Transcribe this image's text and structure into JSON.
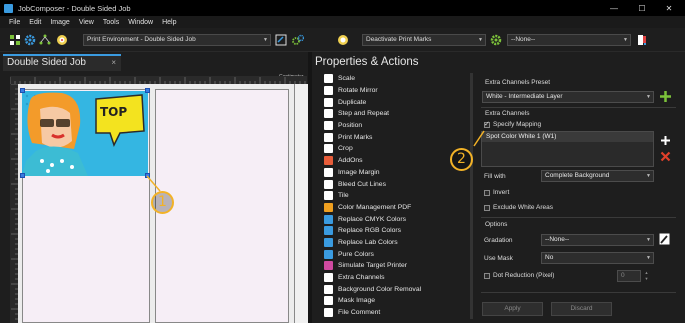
{
  "window": {
    "title": "JobComposer - Double Sided Job",
    "minimize": "—",
    "maximize": "☐",
    "close": "✕"
  },
  "menu": [
    "File",
    "Edit",
    "Image",
    "View",
    "Tools",
    "Window",
    "Help"
  ],
  "toolbar": {
    "print_environment": "Print Environment - Double Sided Job",
    "print_marks": "Deactivate Print Marks",
    "none_select": "--None--"
  },
  "document": {
    "tab_label": "Double Sided Job",
    "tab_close": "×",
    "ruler_unit": "Centimeter",
    "image_text": "TOP"
  },
  "callouts": {
    "one": "1",
    "two": "2"
  },
  "properties": {
    "title": "Properties & Actions",
    "actions": [
      {
        "label": "Scale",
        "icon": "scale-icon",
        "color": "#ffffff"
      },
      {
        "label": "Rotate Mirror",
        "icon": "rotate-mirror-icon",
        "color": "#ffffff"
      },
      {
        "label": "Duplicate",
        "icon": "duplicate-icon",
        "color": "#ffffff"
      },
      {
        "label": "Step and Repeat",
        "icon": "step-repeat-icon",
        "color": "#ffffff"
      },
      {
        "label": "Position",
        "icon": "position-icon",
        "color": "#ffffff"
      },
      {
        "label": "Print Marks",
        "icon": "print-marks-icon",
        "color": "#ffffff"
      },
      {
        "label": "Crop",
        "icon": "crop-icon",
        "color": "#ffffff"
      },
      {
        "label": "AddOns",
        "icon": "addons-icon",
        "color": "#e85d3a"
      },
      {
        "label": "Image Margin",
        "icon": "image-margin-icon",
        "color": "#ffffff"
      },
      {
        "label": "Bleed Cut Lines",
        "icon": "bleed-cut-lines-icon",
        "color": "#ffffff"
      },
      {
        "label": "Tile",
        "icon": "tile-icon",
        "color": "#ffffff"
      },
      {
        "label": "Color Management PDF",
        "icon": "color-management-icon",
        "color": "#f0a020"
      },
      {
        "label": "Replace CMYK Colors",
        "icon": "replace-cmyk-icon",
        "color": "#3a9be0"
      },
      {
        "label": "Replace RGB Colors",
        "icon": "replace-rgb-icon",
        "color": "#3a9be0"
      },
      {
        "label": "Replace Lab Colors",
        "icon": "replace-lab-icon",
        "color": "#3a9be0"
      },
      {
        "label": "Pure Colors",
        "icon": "pure-colors-icon",
        "color": "#3a9be0"
      },
      {
        "label": "Simulate Target Printer",
        "icon": "simulate-printer-icon",
        "color": "#d04aa0"
      },
      {
        "label": "Extra Channels",
        "icon": "extra-channels-icon",
        "color": "#ffffff"
      },
      {
        "label": "Background Color Removal",
        "icon": "background-removal-icon",
        "color": "#ffffff"
      },
      {
        "label": "Mask Image",
        "icon": "mask-image-icon",
        "color": "#ffffff"
      },
      {
        "label": "File Comment",
        "icon": "file-comment-icon",
        "color": "#ffffff"
      }
    ]
  },
  "settings": {
    "preset_label": "Extra Channels Preset",
    "preset_value": "White - Intermediate Layer",
    "extra_channels_label": "Extra Channels",
    "specify_mapping": "Specify Mapping",
    "spot_color": "Spot Color White 1 (W1)",
    "fill_with_label": "Fill with",
    "fill_with_value": "Complete Background",
    "invert": "Invert",
    "exclude_white": "Exclude White Areas",
    "options_label": "Options",
    "gradation_label": "Gradation",
    "gradation_value": "--None--",
    "use_mask_label": "Use Mask",
    "use_mask_value": "No",
    "dot_reduction": "Dot Reduction (Pixel)",
    "dot_value": "0",
    "apply": "Apply",
    "discard": "Discard"
  },
  "colors": {
    "accent_blue": "#3a9be0",
    "callout_orange": "#f2b227",
    "add_green": "#7cc23a",
    "remove_red": "#e0402a"
  }
}
